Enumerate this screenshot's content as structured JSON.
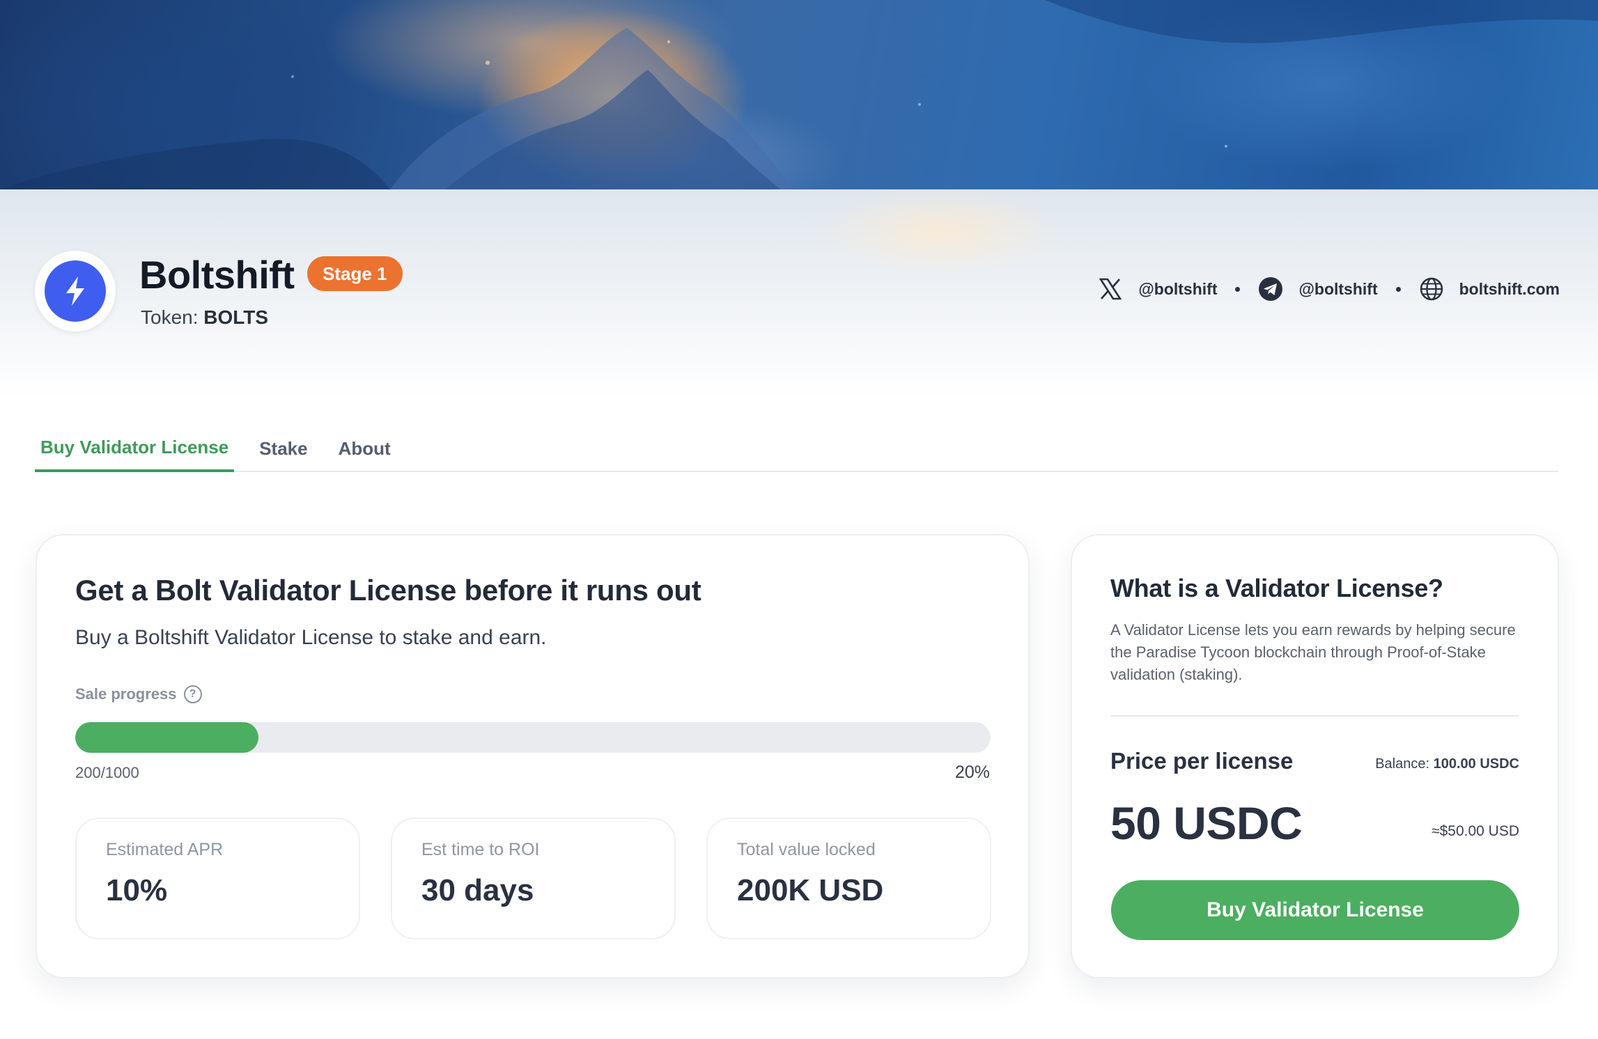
{
  "project": {
    "name": "Boltshift",
    "stage": "Stage 1",
    "token_prefix": "Token: ",
    "token_symbol": "BOLTS",
    "logo_icon": "lightning-bolt-icon",
    "brand_color": "#3f5ef0",
    "stage_color": "#ec7230"
  },
  "socials": [
    {
      "icon": "x-logo-icon",
      "label": "@boltshift"
    },
    {
      "icon": "telegram-icon",
      "label": "@boltshift"
    },
    {
      "icon": "globe-icon",
      "label": "boltshift.com"
    }
  ],
  "tabs": [
    {
      "label": "Buy Validator License",
      "active": true
    },
    {
      "label": "Stake",
      "active": false
    },
    {
      "label": "About",
      "active": false
    }
  ],
  "sale": {
    "title": "Get a Bolt Validator License before it runs out",
    "subtitle": "Buy a Boltshift Validator License to stake and earn.",
    "progress_label": "Sale progress",
    "progress_count": "200/1000",
    "progress_percent": "20%",
    "progress_fraction": 0.2,
    "accent_color": "#4cae61"
  },
  "stats": [
    {
      "label": "Estimated APR",
      "value": "10%"
    },
    {
      "label": "Est time to ROI",
      "value": "30 days"
    },
    {
      "label": "Total value locked",
      "value": "200K USD"
    }
  ],
  "license": {
    "title": "What is a Validator License?",
    "description": "A Validator License lets you earn rewards by helping secure the Paradise Tycoon blockchain through Proof-of-Stake validation (staking).",
    "price_label": "Price per license",
    "balance_label": "Balance: ",
    "balance_value": "100.00 USDC",
    "price": "50 USDC",
    "price_usd": "≈$50.00 USD",
    "buy_label": "Buy Validator License"
  }
}
